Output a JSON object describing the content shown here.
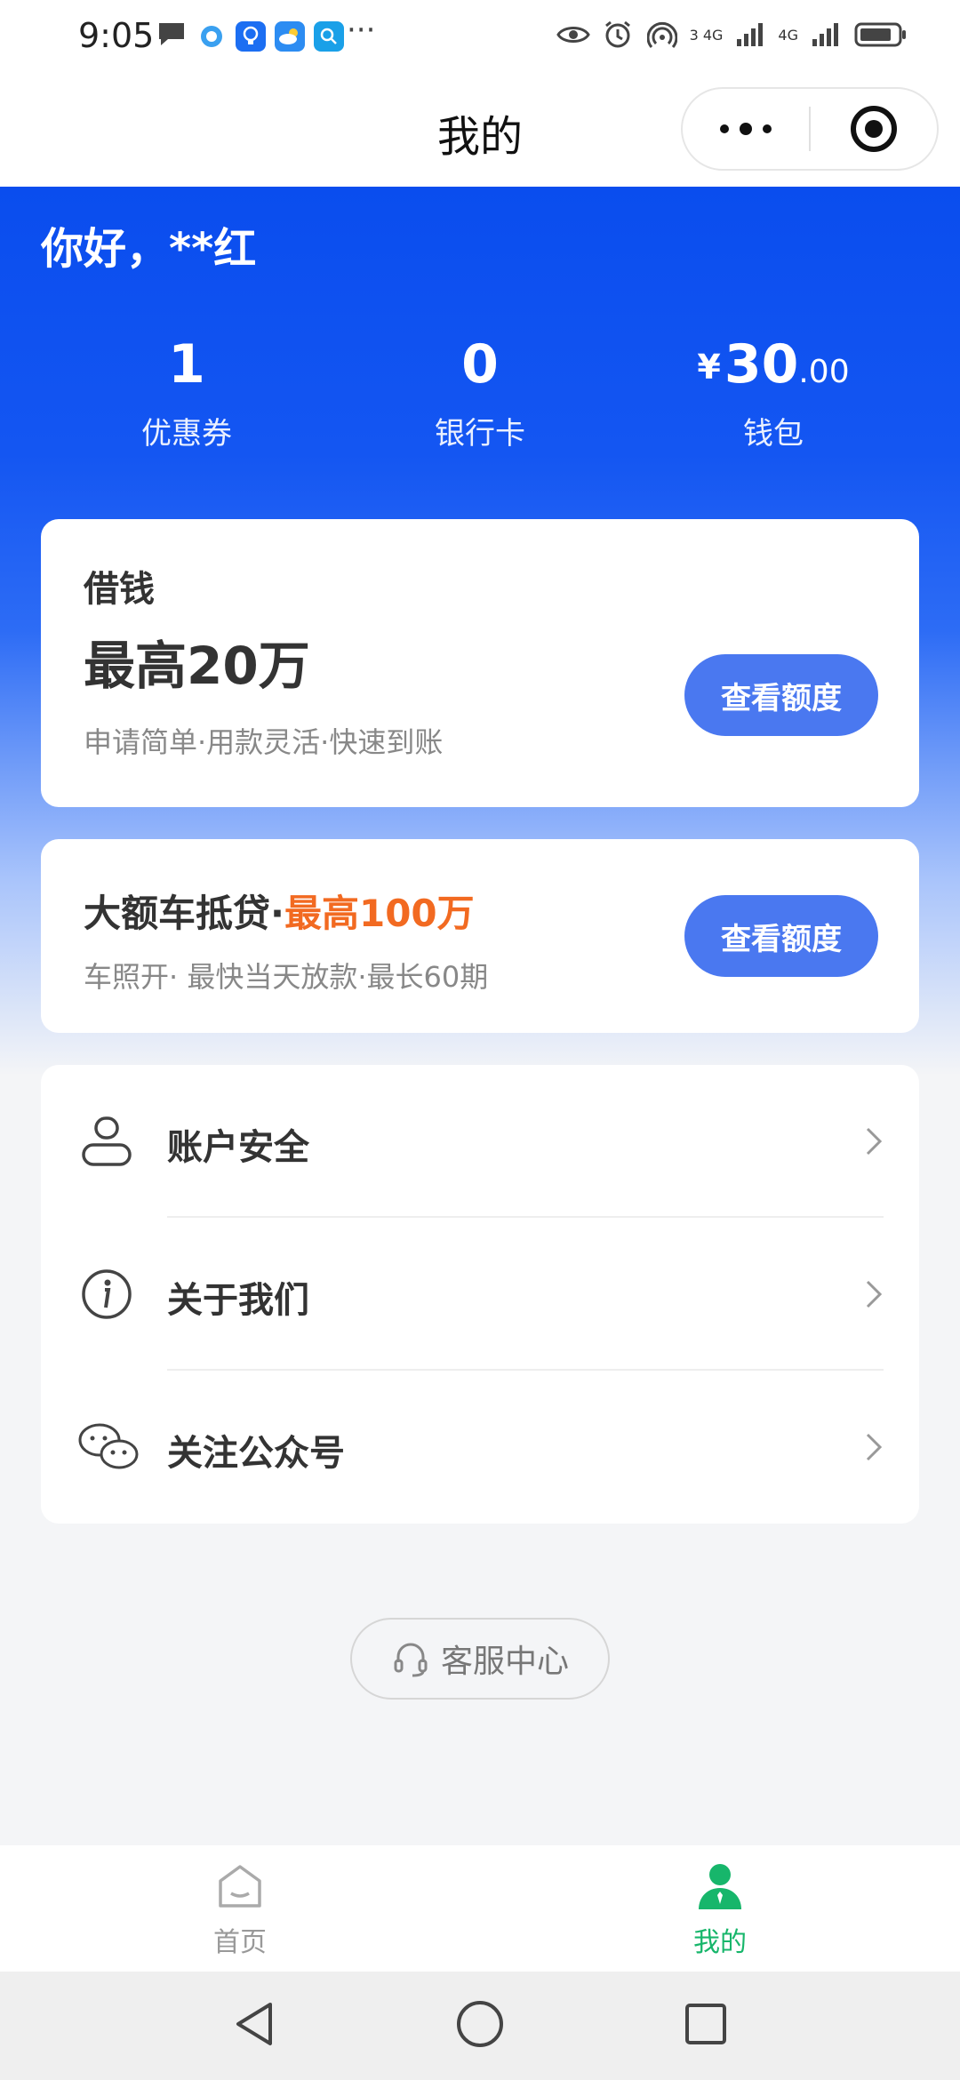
{
  "status_bar": {
    "time": "9:05",
    "more": "···",
    "signal1_label": "3 4G",
    "signal2_label": "4G",
    "icons": [
      "chat-bubble-icon",
      "app-notif-icon",
      "bulb-icon",
      "weather-icon",
      "search-app-icon",
      "eye-icon",
      "alarm-icon",
      "hotspot-icon",
      "signal-icon",
      "signal-icon",
      "battery-icon"
    ]
  },
  "title_bar": {
    "title": "我的"
  },
  "user": {
    "greeting": "你好，**红"
  },
  "stats": [
    {
      "value": "1",
      "label": "优惠券"
    },
    {
      "value": "0",
      "label": "银行卡"
    },
    {
      "currency": "¥",
      "value": "30",
      "decimals": ".00",
      "label": "钱包"
    }
  ],
  "loan_card": {
    "title": "借钱",
    "amount": "最高20万",
    "subtitle": "申请简单·用款灵活·快速到账",
    "button": "查看额度"
  },
  "car_card": {
    "title": "大额车抵贷·",
    "highlight": "最高100万",
    "subtitle": "车照开· 最快当天放款·最长60期",
    "button": "查看额度"
  },
  "menu": [
    {
      "label": "账户安全",
      "icon": "user-icon"
    },
    {
      "label": "关于我们",
      "icon": "info-icon"
    },
    {
      "label": "关注公众号",
      "icon": "wechat-icon"
    }
  ],
  "service": {
    "label": "客服中心",
    "icon": "headset-icon"
  },
  "tabs": [
    {
      "label": "首页",
      "icon": "home-icon",
      "active": false
    },
    {
      "label": "我的",
      "icon": "person-icon",
      "active": true
    }
  ],
  "colors": {
    "brand_blue": "#1456f2",
    "button_blue": "#4a78f0",
    "highlight_orange": "#f26a21",
    "active_green": "#17b66b"
  }
}
